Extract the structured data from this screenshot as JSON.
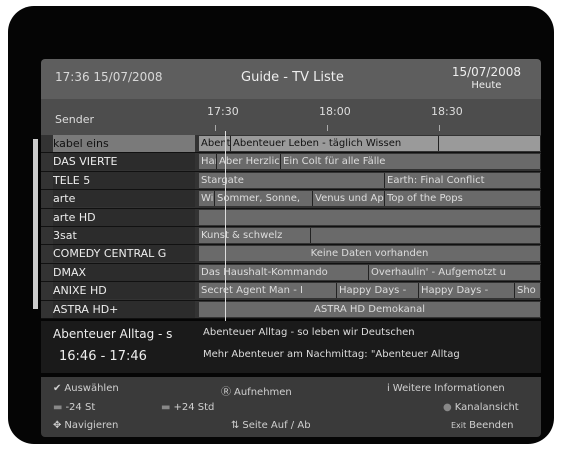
{
  "header": {
    "datetime": "17:36 15/07/2008",
    "title": "Guide - TV Liste",
    "date": "15/07/2008",
    "day": "Heute"
  },
  "timeline": {
    "sender_label": "Sender",
    "times": [
      "17:30",
      "18:00",
      "18:30"
    ]
  },
  "channels": [
    {
      "name": "kabel eins",
      "events": [
        "Abenteu",
        "Abenteuer Leben - täglich Wissen",
        ""
      ]
    },
    {
      "name": "DAS VIERTE",
      "events": [
        "Har",
        "Aber Herzlic",
        "Ein Colt für alle Fälle"
      ]
    },
    {
      "name": "TELE 5",
      "events": [
        "Stargate",
        "Earth: Final Conflict"
      ]
    },
    {
      "name": "arte",
      "events": [
        "Wi",
        "Sommer, Sonne, ",
        "Venus und Ap",
        "Top of the Pops"
      ]
    },
    {
      "name": "arte HD",
      "events": [
        ""
      ]
    },
    {
      "name": "3sat",
      "events": [
        "Kunst & schwelz",
        ""
      ]
    },
    {
      "name": "COMEDY CENTRAL G",
      "events": [
        "Keine Daten vorhanden"
      ]
    },
    {
      "name": "DMAX",
      "events": [
        "Das Haushalt-Kommando",
        "Overhaulin' - Aufgemotzt u"
      ]
    },
    {
      "name": "ANIXE HD",
      "events": [
        "Secret Agent Man - I",
        "Happy Days - ",
        "Happy Days - ",
        "Sho"
      ]
    },
    {
      "name": "ASTRA HD+",
      "events": [
        "ASTRA HD Demokanal"
      ]
    }
  ],
  "info": {
    "title": "Abenteuer Alltag - s",
    "time": "16:46 - 17:46",
    "desc1": "Abenteuer Alltag - so leben wir Deutschen",
    "desc2": "Mehr Abenteuer am Nachmittag: \"Abenteuer Alltag"
  },
  "footer": {
    "select": "Auswählen",
    "record": "Aufnehmen",
    "more_info": "Weitere Informationen",
    "minus24": "-24 St",
    "plus24": "+24 Std",
    "channel_view": "Kanalansicht",
    "navigate": "Navigieren",
    "page": "Seite Auf / Ab",
    "exit_key": "Exit",
    "exit": "Beenden"
  }
}
